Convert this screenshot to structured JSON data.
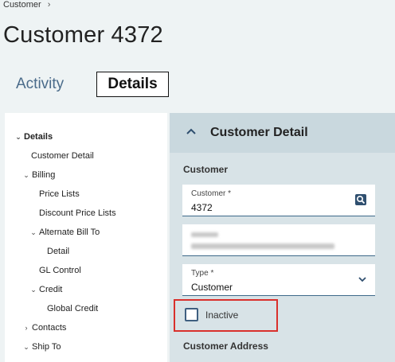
{
  "breadcrumb": {
    "root": "Customer",
    "sep": "›"
  },
  "page": {
    "title": "Customer 4372"
  },
  "tabs": [
    {
      "label": "Activity",
      "active": false
    },
    {
      "label": "Details",
      "active": true
    }
  ],
  "nav": {
    "items": [
      {
        "label": "Details",
        "caret": "⌄"
      },
      {
        "label": "Customer Detail",
        "caret": ""
      },
      {
        "label": "Billing",
        "caret": "⌄"
      },
      {
        "label": "Price Lists",
        "caret": ""
      },
      {
        "label": "Discount Price Lists",
        "caret": ""
      },
      {
        "label": "Alternate Bill To",
        "caret": "⌄"
      },
      {
        "label": "Detail",
        "caret": ""
      },
      {
        "label": "GL Control",
        "caret": ""
      },
      {
        "label": "Credit",
        "caret": "⌄"
      },
      {
        "label": "Global Credit",
        "caret": ""
      },
      {
        "label": "Contacts",
        "caret": "›"
      },
      {
        "label": "Ship To",
        "caret": "⌄"
      }
    ]
  },
  "panel": {
    "title": "Customer Detail",
    "section_customer": "Customer",
    "section_address": "Customer Address",
    "customer_field": {
      "label": "Customer *",
      "value": "4372"
    },
    "type_field": {
      "label": "Type *",
      "value": "Customer"
    },
    "inactive": {
      "label": "Inactive",
      "checked": false
    }
  },
  "colors": {
    "accent": "#3f5f80",
    "highlight_border": "#d9302c",
    "panel_bg": "#d8e3e7"
  }
}
